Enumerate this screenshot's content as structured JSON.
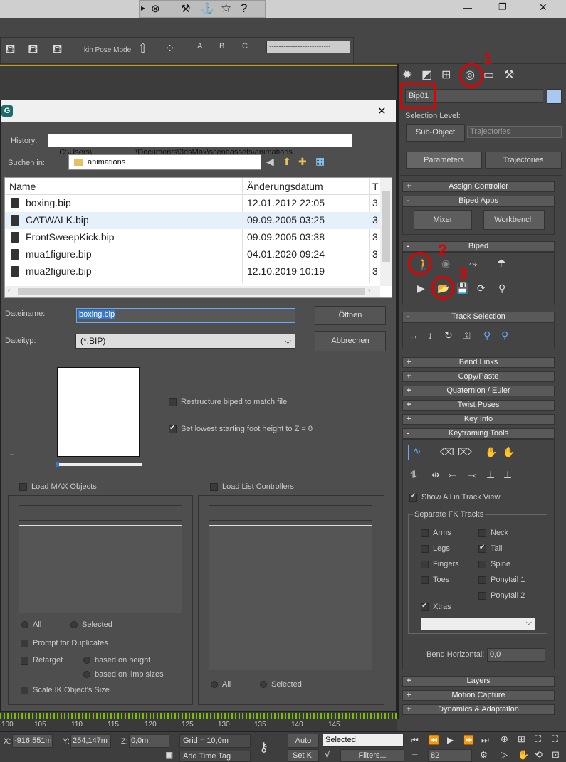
{
  "titlebar": {
    "minimize": "—",
    "restore": "❐",
    "close": "✕"
  },
  "toolbar": {
    "skin_pose_label": "kin Pose Mode",
    "abc": [
      "A",
      "B",
      "C"
    ],
    "dropdown_value": "--------------------------"
  },
  "command_panel": {
    "object_name": "Bip01",
    "selection_level_label": "Selection Level:",
    "sub_object_button": "Sub-Object",
    "trajectories_dropdown": "Trajectories",
    "tab_parameters": "Parameters",
    "tab_trajectories": "Trajectories",
    "rollouts": {
      "assign_controller": "Assign Controller",
      "biped_apps": "Biped Apps",
      "biped": "Biped",
      "track_selection": "Track Selection",
      "bend_links": "Bend Links",
      "copy_paste": "Copy/Paste",
      "quaternion_euler": "Quaternion / Euler",
      "twist_poses": "Twist Poses",
      "key_info": "Key Info",
      "keyframing_tools": "Keyframing Tools",
      "layers": "Layers",
      "motion_capture": "Motion Capture",
      "dynamics_adaptation": "Dynamics & Adaptation"
    },
    "mixer_button": "Mixer",
    "workbench_button": "Workbench",
    "show_all_track_view": "Show All in Track View",
    "separate_fk_tracks": "Separate FK Tracks",
    "fk_tracks_left": [
      {
        "label": "Arms",
        "checked": false
      },
      {
        "label": "Legs",
        "checked": false
      },
      {
        "label": "Fingers",
        "checked": false
      },
      {
        "label": "Toes",
        "checked": false
      }
    ],
    "fk_tracks_right": [
      {
        "label": "Neck",
        "checked": false
      },
      {
        "label": "Tail",
        "checked": true
      },
      {
        "label": "Spine",
        "checked": false
      },
      {
        "label": "Ponytail 1",
        "checked": false
      },
      {
        "label": "Ponytail 2",
        "checked": false
      }
    ],
    "xtras_label": "Xtras",
    "bend_horizontal_label": "Bend Horizontal:",
    "bend_horizontal_value": "0,0",
    "plus": "+",
    "minus": "-",
    "annotations": [
      "1",
      "2",
      "3"
    ]
  },
  "dialog": {
    "history_label": "History:",
    "history_value": "C:\\Users\\                    \\Documents\\3dsMax\\sceneassets\\animations",
    "lookin_label": "Suchen in:",
    "lookin_value": "animations",
    "columns": [
      "Name",
      "Änderungsdatum",
      "T"
    ],
    "files": [
      {
        "name": "boxing.bip",
        "date": "12.01.2012 22:05",
        "t": "3"
      },
      {
        "name": "CATWALK.bip",
        "date": "09.09.2005 03:25",
        "t": "3"
      },
      {
        "name": "FrontSweepKick.bip",
        "date": "09.09.2005 03:38",
        "t": "3"
      },
      {
        "name": "mua1figure.bip",
        "date": "04.01.2020 09:24",
        "t": "3"
      },
      {
        "name": "mua2figure.bip",
        "date": "12.10.2019 10:19",
        "t": "3"
      }
    ],
    "filename_label": "Dateiname:",
    "filename_value": "boxing.bip",
    "open_button": "Öffnen",
    "filetype_label": "Dateityp:",
    "filetype_value": "(*.BIP)",
    "cancel_button": "Abbrechen",
    "restructure_label": "Restructure biped to match file",
    "lowest_foot_label": "Set lowest starting foot height to Z = 0",
    "load_max_objects": "Load MAX Objects",
    "load_list_controllers": "Load List Controllers",
    "all_label": "All",
    "selected_label": "Selected",
    "prompt_duplicates": "Prompt for Duplicates",
    "retarget_label": "Retarget",
    "based_on_height": "based on height",
    "based_on_limb": "based on limb sizes",
    "scale_ik": "Scale IK Object's Size",
    "dash": "–"
  },
  "timeline": {
    "ticks": [
      "100",
      "105",
      "110",
      "115",
      "120",
      "125",
      "130",
      "135",
      "140",
      "145"
    ]
  },
  "status": {
    "x_label": "X:",
    "x_value": "-916,551m",
    "y_label": "Y:",
    "y_value": "254,147m",
    "z_label": "Z:",
    "z_value": "0,0m",
    "grid": "Grid = 10,0m",
    "add_time_tag": "Add Time Tag",
    "auto": "Auto",
    "set_key": "Set K.",
    "selected_dropdown": "Selected",
    "filters": "Filters...",
    "frame": "82"
  }
}
